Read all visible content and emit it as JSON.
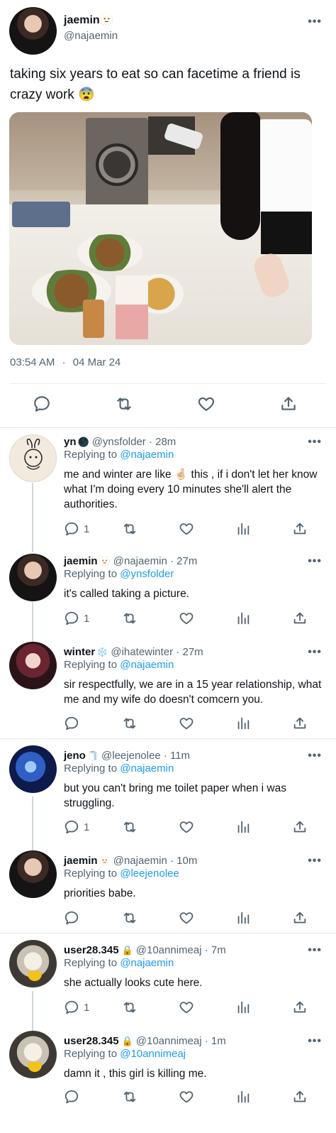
{
  "main": {
    "name": "jaemin",
    "name_emoji": "🫥",
    "handle": "@najaemin",
    "text": "taking six years to eat so can facetime a friend is crazy work 😨",
    "time": "03:54 AM",
    "dot": "·",
    "date": "04 Mar 24",
    "more": "•••"
  },
  "replies": [
    {
      "name": "yn",
      "emoji": "🌑",
      "handle": "@ynsfolder · 28m",
      "replying": "Replying to",
      "to": "@najaemin",
      "text": "me and winter are like 🤞🏻 this , if i don't let her know what I'm doing every 10 minutes she'll alert the authorities.",
      "reply_count": "1"
    },
    {
      "name": "jaemin",
      "emoji": "🫥",
      "handle": "@najaemin · 27m",
      "replying": "Replying to",
      "to": "@ynsfolder",
      "text": "it's called taking a picture.",
      "reply_count": "1"
    },
    {
      "name": "winter",
      "emoji": "❄️",
      "handle": "@ihatewinter · 27m",
      "replying": "Replying to",
      "to": "@najaemin",
      "text": "sir respectfully, we are in a 15 year relationship, what me and my wife do doesn't comcern you.",
      "reply_count": ""
    },
    {
      "name": "jeno",
      "emoji": "🧻",
      "handle": "@leejenolee · 11m",
      "replying": "Replying to",
      "to": "@najaemin",
      "text": "but you can't bring me toilet paper when i was struggling.",
      "reply_count": "1"
    },
    {
      "name": "jaemin",
      "emoji": "🫥",
      "handle": "@najaemin · 10m",
      "replying": "Replying to",
      "to": "@leejenolee",
      "text": "priorities babe.",
      "reply_count": ""
    },
    {
      "name": "user28.345",
      "emoji": "🔒",
      "handle": "@10annimeaj · 7m",
      "replying": "Replying to",
      "to": "@najaemin",
      "text": "she actually looks cute here.",
      "reply_count": "1"
    },
    {
      "name": "user28.345",
      "emoji": "🔒",
      "handle": "@10annimeaj · 1m",
      "replying": "Replying to",
      "to": "@10annimeaj",
      "text": "damn it , this girl is killing me.",
      "reply_count": ""
    }
  ],
  "colors": {
    "link": "#1d9bf0",
    "muted": "#536471",
    "divider": "#e1e8ed"
  },
  "icons": [
    "reply-icon",
    "retweet-icon",
    "like-icon",
    "views-icon",
    "share-icon"
  ]
}
